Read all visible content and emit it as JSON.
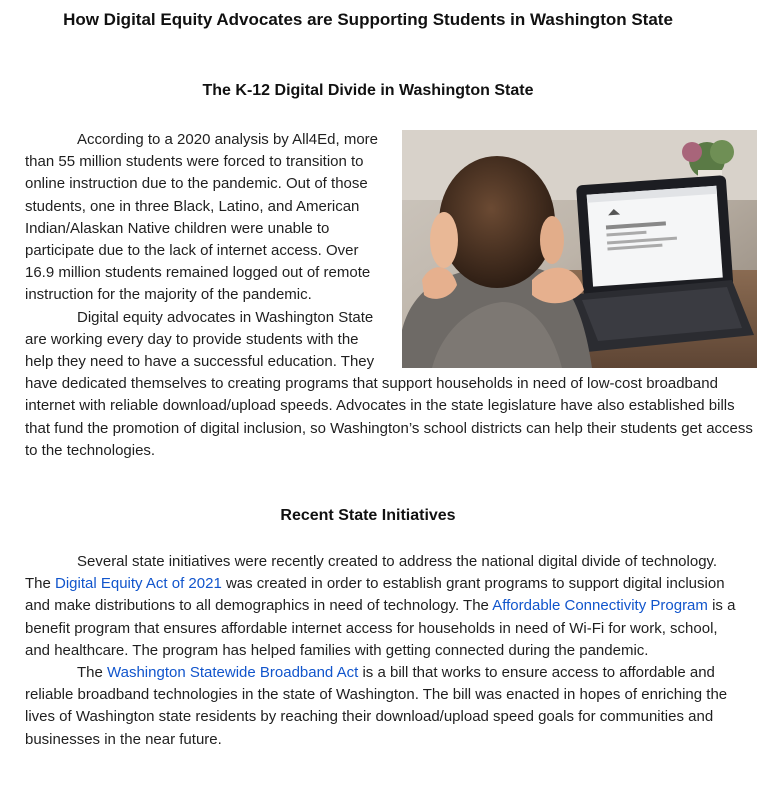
{
  "title": "How Digital Equity Advocates are Supporting Students in Washington State",
  "section1": {
    "heading": "The K-12 Digital Divide in Washington State",
    "photo_icon": "child-using-laptop-photo",
    "p1": "According to a 2020 analysis by All4Ed, more than 55 million students were forced to transition to online instruction due to the pandemic. Out of those students, one in three Black, Latino, and American Indian/Alaskan Native children were unable to participate due to the lack of internet access. Over 16.9 million students remained logged out of remote instruction for the majority of the pandemic.",
    "p2": "Digital equity advocates in Washington State are working every day to provide students with the help they need to have a successful education. They have dedicated themselves to creating programs that support households in need of low-cost broadband internet with reliable download/upload speeds. Advocates in the state legislature have also established bills that fund the promotion of digital inclusion, so Washington’s school districts can help their students get access to the technologies."
  },
  "section2": {
    "heading": "Recent State Initiatives",
    "p1": {
      "t1": "Several state initiatives were recently created to address the national digital divide of technology. The ",
      "link1": "Digital Equity Act of 2021",
      "t2": " was created in order to establish grant programs to support digital inclusion and make distributions to all demographics in need of technology. The ",
      "link2": "Affordable Connectivity Program",
      "t3": " is a benefit program that ensures affordable internet access for households in need of Wi-Fi for work, school, and healthcare. The program has helped families with getting connected during the pandemic."
    },
    "p2": {
      "t1": "The ",
      "link1": "Washington Statewide Broadband Act",
      "t2": " is a bill that works to ensure access to affordable and reliable broadband technologies in the state of Washington. The bill was enacted in hopes of enriching the lives of Washington state residents by reaching their download/upload speed goals for communities and businesses in the near future."
    }
  },
  "colors": {
    "text": "#1f1f1f",
    "link": "#1155cc"
  }
}
